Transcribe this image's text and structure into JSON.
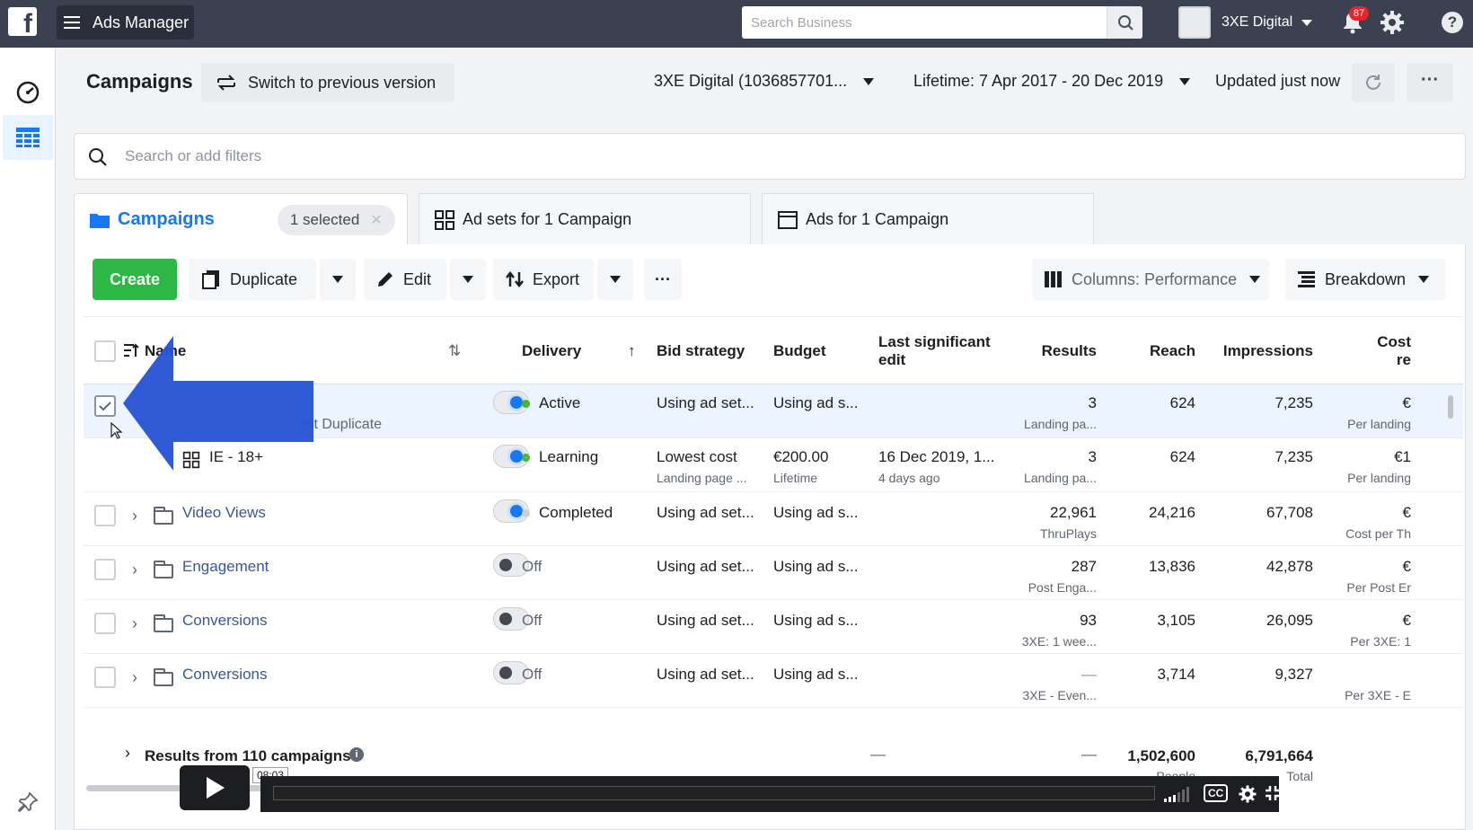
{
  "topbar": {
    "logo_letter": "f",
    "app_name": "Ads Manager",
    "search_placeholder": "Search Business",
    "account_name": "3XE Digital",
    "notification_count": "87"
  },
  "header": {
    "title": "Campaigns",
    "switch_label": "Switch to previous version",
    "account_select": "3XE Digital (1036857701...",
    "date_range": "Lifetime: 7 Apr 2017 - 20 Dec 2019",
    "updated": "Updated just now",
    "more": "···"
  },
  "filter": {
    "placeholder": "Search or add filters"
  },
  "tabs": {
    "campaigns": "Campaigns",
    "selected_chip": "1 selected",
    "adsets": "Ad sets for 1 Campaign",
    "ads": "Ads for 1 Campaign"
  },
  "toolbar": {
    "create": "Create",
    "duplicate": "Duplicate",
    "edit": "Edit",
    "export": "Export",
    "more": "···",
    "columns_label": "Columns:",
    "columns_value": "Performance",
    "breakdown": "Breakdown"
  },
  "columns": {
    "name": "Name",
    "delivery": "Delivery",
    "bid": "Bid strategy",
    "budget": "Budget",
    "last_edit": "Last significant edit",
    "results": "Results",
    "reach": "Reach",
    "impressions": "Impressions",
    "cost": "Cost re"
  },
  "rows": [
    {
      "name": "",
      "hover_actions": "dit  Duplicate",
      "delivery": "Active",
      "delivery_color": "#42b72a",
      "bid": "Using ad set...",
      "bid_sub": "",
      "budget": "Using ad s...",
      "budget_sub": "",
      "last_edit": "",
      "last_edit_sub": "",
      "results": "3",
      "results_sub": "Landing pa...",
      "reach": "624",
      "impressions": "7,235",
      "cost": "€",
      "cost_sub": "Per landing"
    },
    {
      "name": "IE - 18+",
      "delivery": "Learning",
      "delivery_color": "#42b72a",
      "bid": "Lowest cost",
      "bid_sub": "Landing page ...",
      "budget": "€200.00",
      "budget_sub": "Lifetime",
      "last_edit": "16 Dec 2019, 1...",
      "last_edit_sub": "4 days ago",
      "results": "3",
      "results_sub": "Landing pa...",
      "reach": "624",
      "impressions": "7,235",
      "cost": "€1",
      "cost_sub": "Per landing"
    },
    {
      "name": "Video Views",
      "delivery": "Completed",
      "delivery_color": "#ccd0d5",
      "bid": "Using ad set...",
      "budget": "Using ad s...",
      "results": "22,961",
      "results_sub": "ThruPlays",
      "reach": "24,216",
      "impressions": "67,708",
      "cost": "€",
      "cost_sub": "Cost per Th"
    },
    {
      "name": "Engagement",
      "delivery": "Off",
      "bid": "Using ad set...",
      "budget": "Using ad s...",
      "results": "287",
      "results_sub": "Post Enga...",
      "reach": "13,836",
      "impressions": "42,878",
      "cost": "€",
      "cost_sub": "Per Post Er"
    },
    {
      "name": "Conversions",
      "delivery": "Off",
      "bid": "Using ad set...",
      "budget": "Using ad s...",
      "results": "93",
      "results_sub": "3XE: 1 wee...",
      "reach": "3,105",
      "impressions": "26,095",
      "cost": "€",
      "cost_sub": "Per 3XE: 1"
    },
    {
      "name": "Conversions",
      "delivery": "Off",
      "bid": "Using ad set...",
      "budget": "Using ad s...",
      "results": "—",
      "results_sub": "3XE - Even...",
      "reach": "3,714",
      "impressions": "9,327",
      "cost": "",
      "cost_sub": "Per 3XE - E"
    }
  ],
  "totals": {
    "label": "Results from 110 campaigns",
    "last_edit": "—",
    "results": "—",
    "reach": "1,502,600",
    "reach_sub": "People",
    "impressions": "6,791,664",
    "impressions_sub": "Total"
  },
  "video": {
    "time": "08:03",
    "cc": "CC"
  }
}
